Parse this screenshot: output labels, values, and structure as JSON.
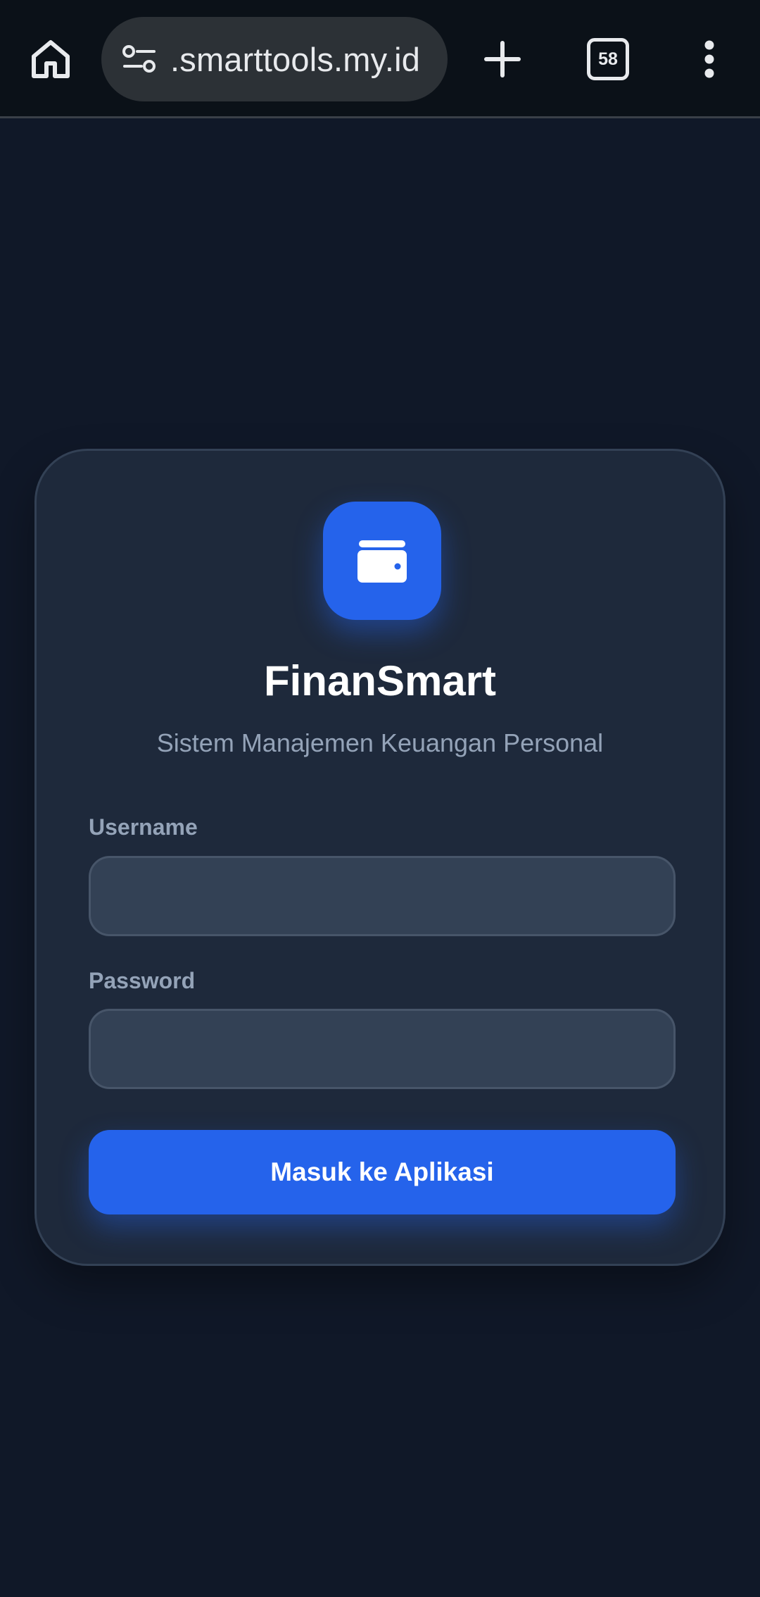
{
  "browser": {
    "url": ".smarttools.my.id",
    "tab_count": "58",
    "icons": {
      "home": "home-icon",
      "site_settings": "tune-icon",
      "new_tab": "plus-icon",
      "tabs": "tab-switcher-icon",
      "menu": "more-vert-icon"
    }
  },
  "login": {
    "logo_icon": "wallet-icon",
    "title": "FinanSmart",
    "subtitle": "Sistem Manajemen Keuangan Personal",
    "username_label": "Username",
    "username_value": "",
    "password_label": "Password",
    "password_value": "",
    "submit_label": "Masuk ke Aplikasi"
  },
  "colors": {
    "page_background": "#101828",
    "card_background": "#1e293b",
    "accent": "#2563eb",
    "input_background": "#334155",
    "muted_text": "#94a3b8"
  }
}
